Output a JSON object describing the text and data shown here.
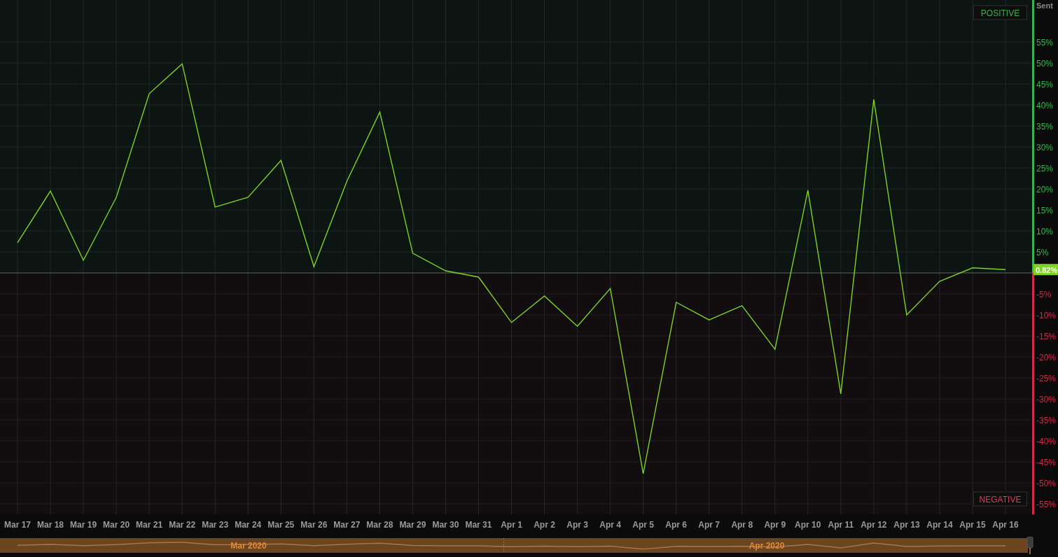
{
  "chart": {
    "chart_data": {
      "type": "line",
      "grid": true,
      "categories": [
        "Mar 17",
        "Mar 18",
        "Mar 19",
        "Mar 20",
        "Mar 21",
        "Mar 22",
        "Mar 23",
        "Mar 24",
        "Mar 25",
        "Mar 26",
        "Mar 27",
        "Mar 28",
        "Mar 29",
        "Mar 30",
        "Mar 31",
        "Apr 1",
        "Apr 2",
        "Apr 3",
        "Apr 4",
        "Apr 5",
        "Apr 6",
        "Apr 7",
        "Apr 8",
        "Apr 9",
        "Apr 10",
        "Apr 11",
        "Apr 12",
        "Apr 13",
        "Apr 14",
        "Apr 15",
        "Apr 16"
      ],
      "series": [
        {
          "name": "Sent",
          "color": "#7ed321",
          "values": [
            7.2,
            19.5,
            3,
            18,
            42.7,
            49.8,
            15.7,
            18,
            26.8,
            1.5,
            21.8,
            38.3,
            4.7,
            0.5,
            -1,
            -11.8,
            -5.5,
            -12.7,
            -3.7,
            -47.8,
            -7,
            -11.2,
            -7.8,
            -18.2,
            19.7,
            -28.8,
            41.3,
            -10,
            -2,
            1.2,
            0.8
          ]
        }
      ],
      "ylim": [
        -57.5,
        65
      ],
      "yticks": [
        {
          "value": 55,
          "label": "55%"
        },
        {
          "value": 50,
          "label": "50%"
        },
        {
          "value": 45,
          "label": "45%"
        },
        {
          "value": 40,
          "label": "40%"
        },
        {
          "value": 35,
          "label": "35%"
        },
        {
          "value": 30,
          "label": "30%"
        },
        {
          "value": 25,
          "label": "25%"
        },
        {
          "value": 20,
          "label": "20%"
        },
        {
          "value": 15,
          "label": "15%"
        },
        {
          "value": 10,
          "label": "10%"
        },
        {
          "value": 5,
          "label": "5%"
        },
        {
          "value": -5,
          "label": "-5%"
        },
        {
          "value": -10,
          "label": "-10%"
        },
        {
          "value": -15,
          "label": "-15%"
        },
        {
          "value": -20,
          "label": "-20%"
        },
        {
          "value": -25,
          "label": "-25%"
        },
        {
          "value": -30,
          "label": "-30%"
        },
        {
          "value": -35,
          "label": "-35%"
        },
        {
          "value": -40,
          "label": "-40%"
        },
        {
          "value": -45,
          "label": "-45%"
        },
        {
          "value": -50,
          "label": "-50%"
        },
        {
          "value": -55,
          "label": "-55%"
        }
      ]
    },
    "current_value": "0.82%",
    "positive_label": "POSITIVE",
    "negative_label": "NEGATIVE"
  },
  "navigator": {
    "labels": [
      "Mar 2020",
      "Apr 2020"
    ]
  }
}
